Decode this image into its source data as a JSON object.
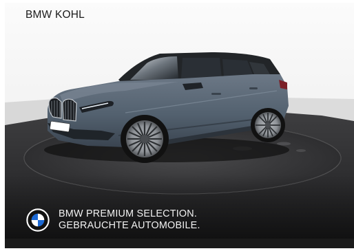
{
  "dealer": {
    "name": "BMW KOHL"
  },
  "vehicle": {
    "paint_color": "#53616f",
    "floor_color": "#2f2f31",
    "wall_color": "#f2f2f2"
  },
  "branding": {
    "logo_icon": "bmw-roundel-icon",
    "line1": "BMW PREMIUM SELECTION.",
    "line2": "GEBRAUCHTE AUTOMOBILE."
  }
}
